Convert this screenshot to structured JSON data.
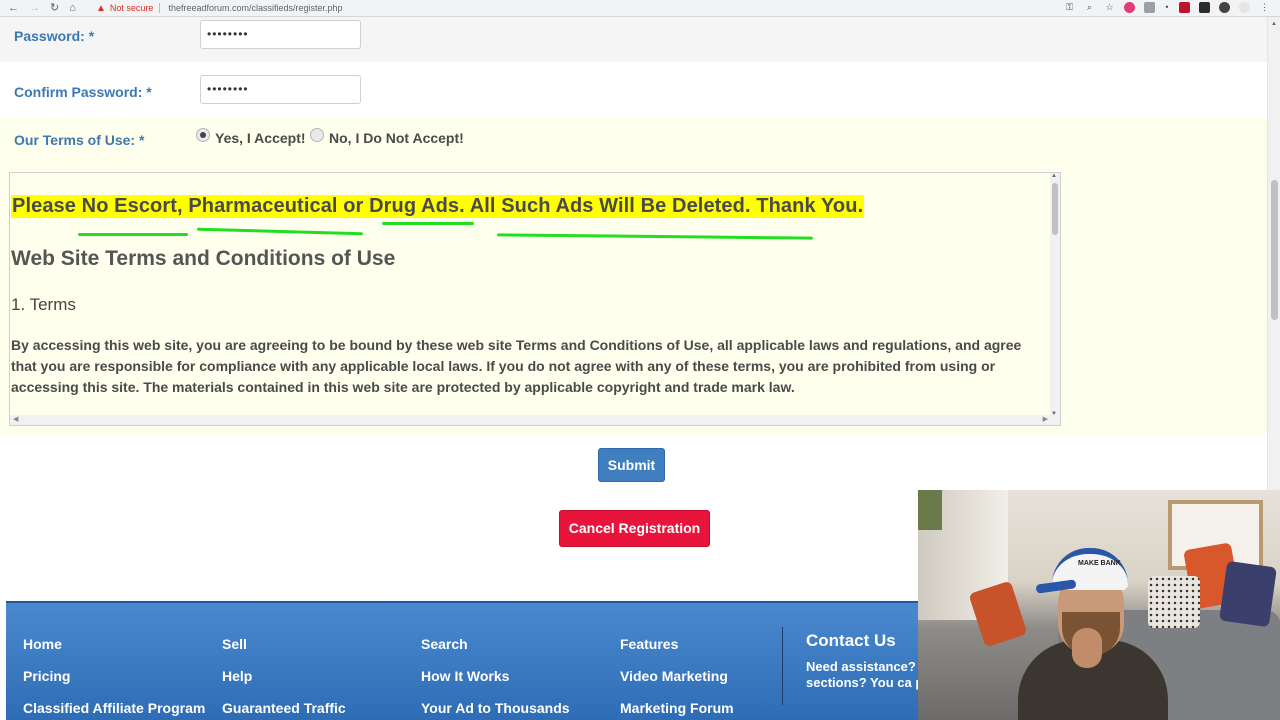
{
  "browser": {
    "not_secure_label": "Not secure",
    "url": "thefreeadforum.com/classifieds/register.php"
  },
  "form": {
    "password_label": "Password: *",
    "password_value": "••••••••",
    "confirm_label": "Confirm Password: *",
    "confirm_value": "••••••••",
    "terms_label": "Our Terms of Use: *",
    "accept_label": "Yes, I Accept!",
    "decline_label": "No, I Do Not Accept!",
    "accept_selected": true
  },
  "terms": {
    "warning": "Please No Escort, Pharmaceutical or Drug Ads. All Such Ads Will Be Deleted. Thank You.",
    "title": "Web Site Terms and Conditions of Use",
    "section": "1. Terms",
    "body": "By accessing this web site, you are agreeing to be bound by these web site Terms and Conditions of Use, all applicable laws and regulations, and agree that you are responsible for compliance with any applicable local laws. If you do not agree with any of these terms, you are prohibited from using or accessing this site. The materials contained in this web site are protected by applicable copyright and trade mark law."
  },
  "buttons": {
    "submit": "Submit",
    "cancel": "Cancel Registration"
  },
  "footer": {
    "col1": [
      "Home",
      "Pricing",
      "Classified Affiliate Program"
    ],
    "col2": [
      "Sell",
      "Help",
      "Guaranteed Traffic"
    ],
    "col3": [
      "Search",
      "How It Works",
      "Your Ad to Thousands"
    ],
    "col4": [
      "Features",
      "Video Marketing",
      "Marketing Forum"
    ],
    "contact_title": "Contact Us",
    "contact_text": "Need assistance? sections? You ca page."
  },
  "webcam": {
    "cap_text": "MAKE BANK"
  },
  "colors": {
    "label_blue": "#3c78b4",
    "highlight_yellow": "#ffff00",
    "annotation_green": "#22dd22",
    "submit_blue": "#3f7fc0",
    "cancel_red": "#e8143c",
    "footer_blue": "#3a7bc4"
  }
}
